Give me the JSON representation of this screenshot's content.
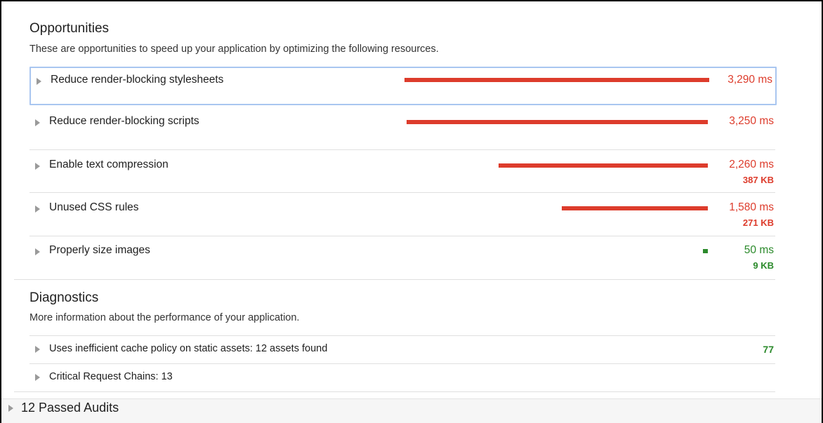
{
  "colors": {
    "fail": "#dd3c2c",
    "pass": "#2b8a2b",
    "focus_outline": "#a9c6f0"
  },
  "opportunities": {
    "title": "Opportunities",
    "description": "These are opportunities to speed up your application by optimizing the following resources.",
    "items": [
      {
        "label": "Reduce render-blocking stylesheets",
        "value": "3,290 ms",
        "sub": "",
        "status": "fail",
        "duration_ms": 3290,
        "focused": true
      },
      {
        "label": "Reduce render-blocking scripts",
        "value": "3,250 ms",
        "sub": "",
        "status": "fail",
        "duration_ms": 3250,
        "focused": false
      },
      {
        "label": "Enable text compression",
        "value": "2,260 ms",
        "sub": "387 KB",
        "status": "fail",
        "duration_ms": 2260,
        "focused": false
      },
      {
        "label": "Unused CSS rules",
        "value": "1,580 ms",
        "sub": "271 KB",
        "status": "fail",
        "duration_ms": 1580,
        "focused": false
      },
      {
        "label": "Properly size images",
        "value": "50 ms",
        "sub": "9 KB",
        "status": "pass",
        "duration_ms": 50,
        "focused": false
      }
    ]
  },
  "diagnostics": {
    "title": "Diagnostics",
    "description": "More information about the performance of your application.",
    "items": [
      {
        "label": "Uses inefficient cache policy on static assets: 12 assets found",
        "value": "77",
        "status": "pass"
      },
      {
        "label": "Critical Request Chains: 13",
        "value": "",
        "status": "none"
      }
    ]
  },
  "passed": {
    "label": "12 Passed Audits"
  }
}
